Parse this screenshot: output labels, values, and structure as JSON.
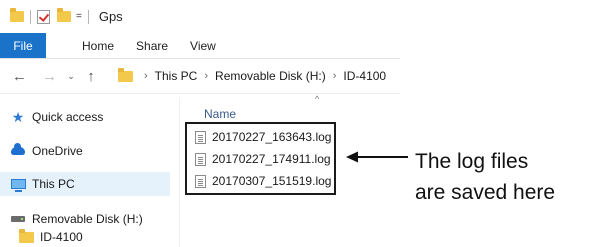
{
  "window": {
    "title": "Gps",
    "qat_dropdown": "="
  },
  "ribbon": {
    "tabs": [
      "File",
      "Home",
      "Share",
      "View"
    ]
  },
  "address": {
    "back": "←",
    "forward": "→",
    "recent": "⌄",
    "up": "↑",
    "crumbs": [
      "This PC",
      "Removable Disk (H:)",
      "ID-4100"
    ]
  },
  "nav_pane": {
    "items": [
      {
        "label": "Quick access",
        "icon": "star-icon"
      },
      {
        "label": "OneDrive",
        "icon": "cloud-icon"
      },
      {
        "label": "This PC",
        "icon": "computer-icon",
        "selected": true
      },
      {
        "label": "Removable Disk (H:)",
        "icon": "drive-icon"
      },
      {
        "label": "ID-4100",
        "icon": "folder-icon"
      }
    ]
  },
  "content": {
    "column_name": "Name",
    "sort_indicator": "^",
    "files": [
      "20170227_163643.log",
      "20170227_174911.log",
      "20170307_151519.log"
    ]
  },
  "annotation": {
    "lines": [
      "The log files",
      "are saved here"
    ]
  },
  "colors": {
    "accent": "#1a73c9",
    "folder": "#f3c94b",
    "selection": "#e5f1fb"
  }
}
